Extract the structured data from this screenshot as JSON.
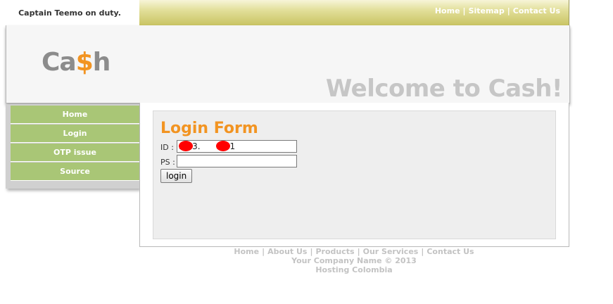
{
  "tagline": "Captain Teemo on duty.",
  "topnav": {
    "home": "Home",
    "sitemap": "Sitemap",
    "contact": "Contact Us",
    "separator": "|"
  },
  "logo": {
    "prefix": "Ca",
    "dollar": "$",
    "suffix": "h"
  },
  "welcome": "Welcome to Cash!",
  "sidebar": {
    "items": [
      {
        "label": "Home"
      },
      {
        "label": "Login"
      },
      {
        "label": "OTP issue"
      },
      {
        "label": "Source"
      }
    ]
  },
  "login_form": {
    "title": "Login Form",
    "id_label": "ID :",
    "id_value": ".183.      .101",
    "ps_label": "PS :",
    "ps_value": "",
    "button": "login"
  },
  "footer": {
    "links": [
      "Home",
      "About Us",
      "Products",
      "Our Services",
      "Contact Us"
    ],
    "separator": "|",
    "copyright": "Your Company Name © 2013",
    "hosting": "Hosting Colombia"
  },
  "colors": {
    "accent_orange": "#f29422",
    "sidebar_green": "#a9c676",
    "topbar_olive": "#c9c463",
    "redaction": "#ff0000"
  }
}
